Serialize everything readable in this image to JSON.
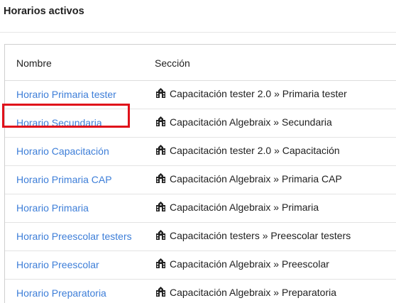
{
  "header": {
    "title": "Horarios activos"
  },
  "table": {
    "columns": {
      "name": "Nombre",
      "section": "Sección"
    },
    "rows": [
      {
        "name": "Horario Primaria tester",
        "section": "Capacitación tester 2.0 » Primaria tester"
      },
      {
        "name": "Horario Secundaria",
        "section": "Capacitación Algebraix » Secundaria"
      },
      {
        "name": "Horario Capacitación",
        "section": "Capacitación tester 2.0 » Capacitación"
      },
      {
        "name": "Horario Primaria CAP",
        "section": "Capacitación Algebraix » Primaria CAP"
      },
      {
        "name": "Horario Primaria",
        "section": "Capacitación Algebraix » Primaria"
      },
      {
        "name": "Horario Preescolar testers",
        "section": "Capacitación testers » Preescolar testers"
      },
      {
        "name": "Horario Preescolar",
        "section": "Capacitación Algebraix » Preescolar"
      },
      {
        "name": "Horario Preparatoria",
        "section": "Capacitación Algebraix » Preparatoria"
      }
    ],
    "section_icon": "school-building-icon"
  },
  "colors": {
    "link": "#3d7ed8",
    "highlight": "#e0101a",
    "text": "#212121"
  }
}
